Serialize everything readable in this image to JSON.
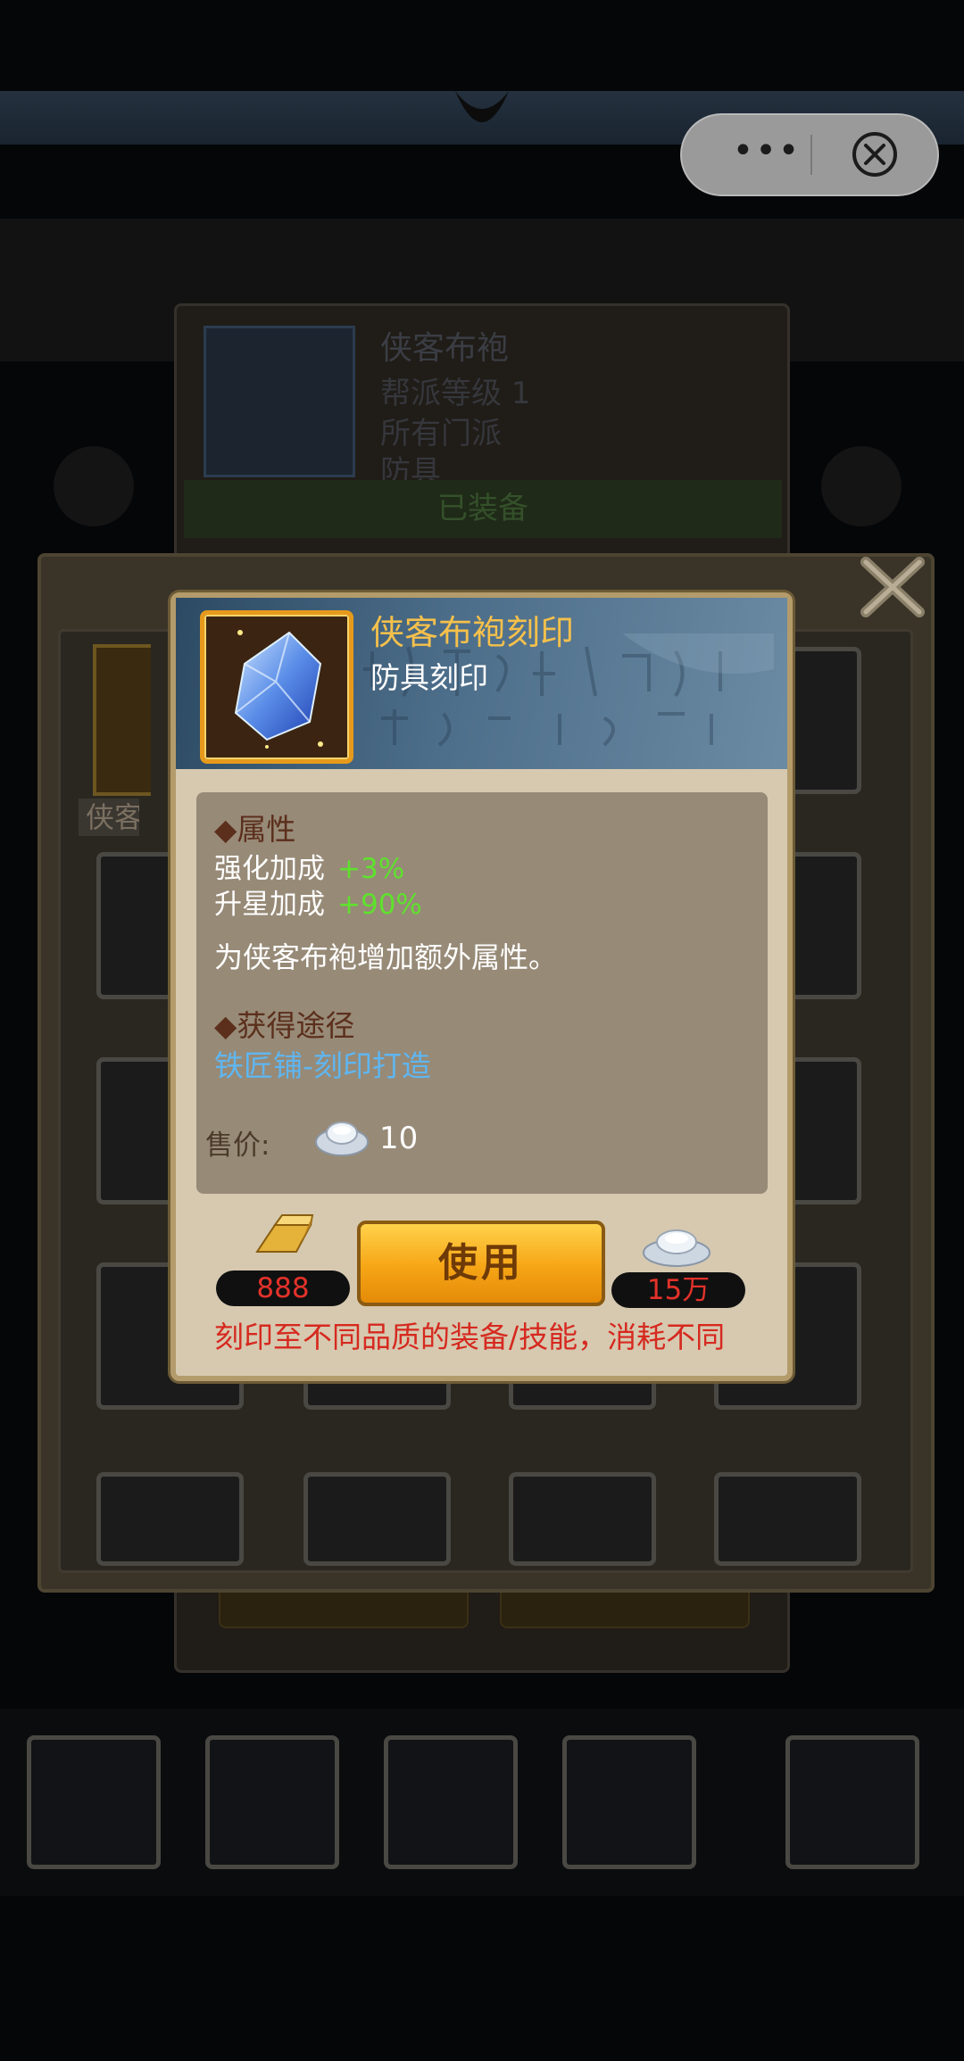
{
  "capsule": {
    "more_label": "•••"
  },
  "background_card": {
    "item_name": "侠客布袍",
    "guild_level": "帮派等级 1",
    "sect": "所有门派",
    "type": "防具",
    "equipped": "已装备"
  },
  "bag": {
    "item_label": "侠客布"
  },
  "popup": {
    "title": "侠客布袍刻印",
    "subtitle": "防具刻印",
    "attributes_heading": "◆属性",
    "attributes": [
      {
        "name": "强化加成",
        "value": "+3%"
      },
      {
        "name": "升星加成",
        "value": "+90%"
      }
    ],
    "description": "为侠客布袍增加额外属性。",
    "source_heading": "◆获得途径",
    "source_link": "铁匠铺-刻印打造",
    "price_label": "售价:",
    "price_value": "10",
    "gold_amount": "888",
    "use_button": "使用",
    "silver_amount": "15万",
    "warning": "刻印至不同品质的装备/技能，消耗不同"
  },
  "colors": {
    "title": "#f5c04b",
    "attribute_value": "#5ee22d",
    "link": "#5fb6f0",
    "warning": "#d6291f",
    "button": "#f6a516"
  },
  "icons": [
    "more-icon",
    "close-circle-icon",
    "crystal-icon",
    "gold-bar-icon",
    "silver-ingot-icon",
    "bag-close-icon"
  ]
}
